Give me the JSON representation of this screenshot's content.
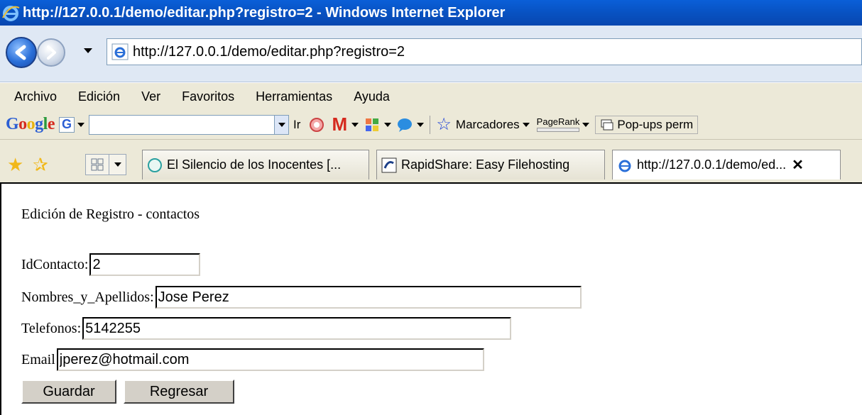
{
  "window": {
    "title": "http://127.0.0.1/demo/editar.php?registro=2 - Windows Internet Explorer"
  },
  "address": {
    "url": "http://127.0.0.1/demo/editar.php?registro=2"
  },
  "menu": {
    "items": [
      "Archivo",
      "Edición",
      "Ver",
      "Favoritos",
      "Herramientas",
      "Ayuda"
    ]
  },
  "google_toolbar": {
    "logo": "Google",
    "go_label": "Ir",
    "bookmarks_label": "Marcadores",
    "pagerank_label": "PageRank",
    "popups_label": "Pop-ups perm"
  },
  "tabs": [
    {
      "title": "El Silencio de los Inocentes [..."
    },
    {
      "title": "RapidShare: Easy Filehosting"
    },
    {
      "title": "http://127.0.0.1/demo/ed..."
    }
  ],
  "page": {
    "heading": "Edición de Registro - contactos",
    "fields": {
      "id": {
        "label": "IdContacto:",
        "value": "2"
      },
      "name": {
        "label": "Nombres_y_Apellidos:",
        "value": "Jose Perez"
      },
      "phone": {
        "label": "Telefonos:",
        "value": "5142255"
      },
      "email": {
        "label": "Email",
        "value": "jperez@hotmail.com"
      }
    },
    "buttons": {
      "save": "Guardar",
      "back": "Regresar"
    }
  }
}
